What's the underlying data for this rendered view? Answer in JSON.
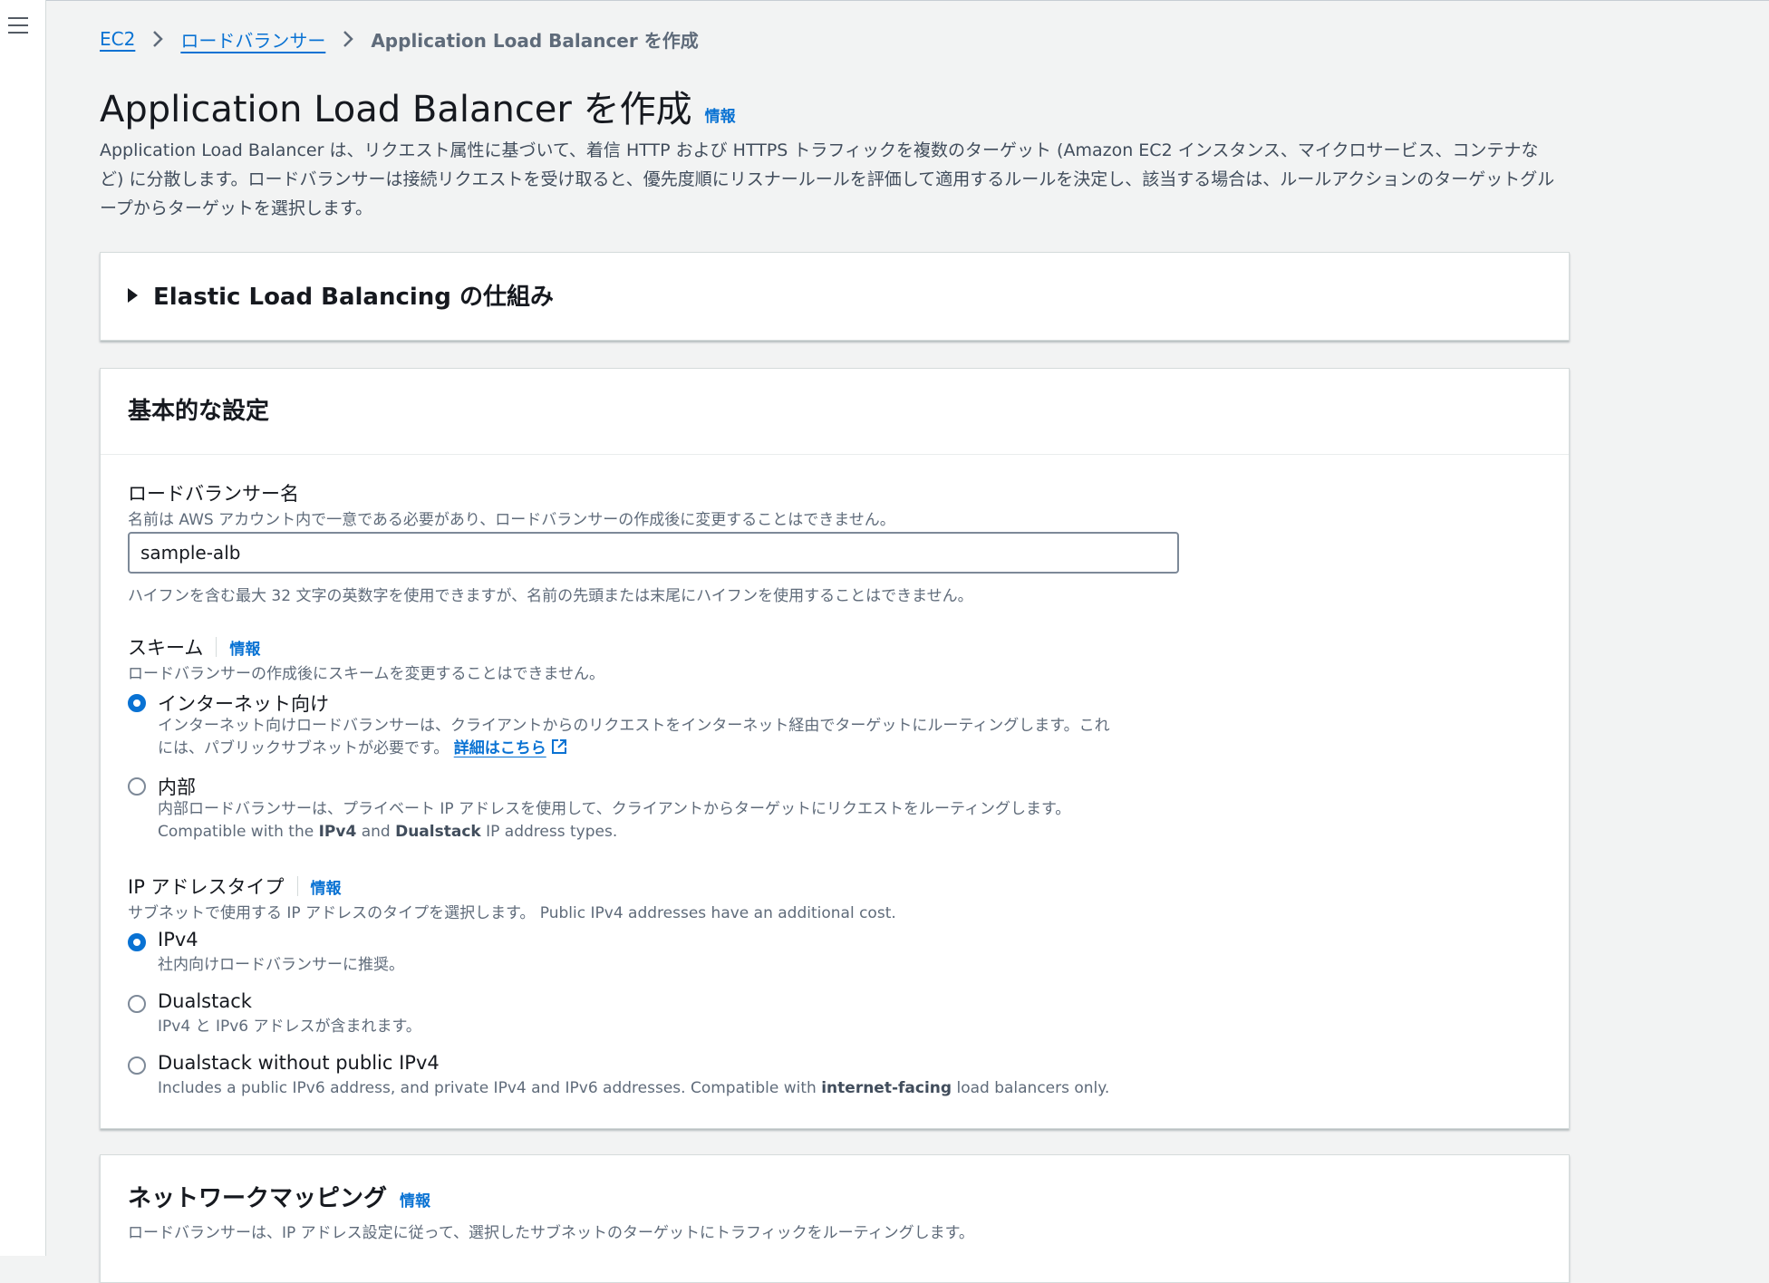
{
  "breadcrumb": {
    "ec2": "EC2",
    "load_balancers": "ロードバランサー",
    "current": "Application Load Balancer を作成"
  },
  "page": {
    "title": "Application Load Balancer を作成",
    "info": "情報",
    "description": "Application Load Balancer は、リクエスト属性に基づいて、着信 HTTP および HTTPS トラフィックを複数のターゲット (Amazon EC2 インスタンス、マイクロサービス、コンテナなど) に分散します。ロードバランサーは接続リクエストを受け取ると、優先度順にリスナールールを評価して適用するルールを決定し、該当する場合は、ルールアクションのターゲットグループからターゲットを選択します。"
  },
  "how_it_works": {
    "title": "Elastic Load Balancing の仕組み"
  },
  "basic_config": {
    "title": "基本的な設定",
    "name": {
      "label": "ロードバランサー名",
      "description": "名前は AWS アカウント内で一意である必要があり、ロードバランサーの作成後に変更することはできません。",
      "value": "sample-alb",
      "constraint": "ハイフンを含む最大 32 文字の英数字を使用できますが、名前の先頭または末尾にハイフンを使用することはできません。"
    },
    "scheme": {
      "label": "スキーム",
      "info": "情報",
      "description": "ロードバランサーの作成後にスキームを変更することはできません。",
      "options": [
        {
          "label": "インターネット向け",
          "selected": true,
          "desc_line1": "インターネット向けロードバランサーは、クライアントからのリクエストをインターネット経由でターゲットにルーティングします。これ",
          "desc_line2": "には、パブリックサブネットが必要です。",
          "link": "詳細はこちら",
          "link_icon": "external-link-icon"
        },
        {
          "label": "内部",
          "selected": false,
          "desc_line1": "内部ロードバランサーは、プライベート IP アドレスを使用して、クライアントからターゲットにリクエストをルーティングします。",
          "desc_line2_parts": [
            "Compatible with the ",
            "IPv4",
            " and ",
            "Dualstack",
            " IP address types."
          ]
        }
      ]
    },
    "ip_type": {
      "label": "IP アドレスタイプ",
      "info": "情報",
      "description": "サブネットで使用する IP アドレスのタイプを選択します。 Public IPv4 addresses have an additional cost.",
      "options": [
        {
          "label": "IPv4",
          "selected": true,
          "desc": "社内向けロードバランサーに推奨。"
        },
        {
          "label": "Dualstack",
          "selected": false,
          "desc": "IPv4 と IPv6 アドレスが含まれます。"
        },
        {
          "label": "Dualstack without public IPv4",
          "selected": false,
          "desc_parts": [
            "Includes a public IPv6 address, and private IPv4 and IPv6 addresses. Compatible with ",
            "internet-facing",
            " load balancers only."
          ]
        }
      ]
    }
  },
  "network_mapping": {
    "title": "ネットワークマッピング",
    "info": "情報",
    "description": "ロードバランサーは、IP アドレス設定に従って、選択したサブネットのターゲットにトラフィックをルーティングします。"
  },
  "colors": {
    "link": "#0972d3",
    "background": "#f2f3f3",
    "text": "#16191f",
    "secondary_text": "#5f6b7a"
  },
  "icons": {
    "menu": "hamburger-icon",
    "breadcrumb_separator": "chevron-right-icon",
    "expand": "caret-right-icon",
    "external": "external-link-icon"
  }
}
